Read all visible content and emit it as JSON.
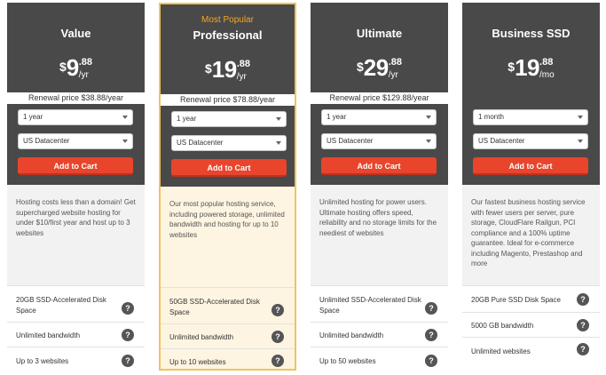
{
  "plans": [
    {
      "badge": "",
      "name": "Value",
      "currency": "$",
      "price_int": "9",
      "price_dec": ".88",
      "period": "/yr",
      "renewal": "Renewal price $38.88/year",
      "term": "1 year",
      "datacenter": "US Datacenter",
      "cta": "Add to Cart",
      "description": "Hosting costs less than a domain! Get supercharged website hosting for under $10/first year and host up to 3 websites",
      "features": [
        "20GB SSD-Accelerated Disk Space",
        "Unlimited bandwidth",
        "Up to 3 websites"
      ]
    },
    {
      "badge": "Most Popular",
      "name": "Professional",
      "currency": "$",
      "price_int": "19",
      "price_dec": ".88",
      "period": "/yr",
      "renewal": "Renewal price $78.88/year",
      "term": "1 year",
      "datacenter": "US Datacenter",
      "cta": "Add to Cart",
      "description": "Our most popular hosting service, including powered storage, unlimited bandwidth and hosting for up to 10 websites",
      "features": [
        "50GB SSD-Accelerated Disk Space",
        "Unlimited bandwidth",
        "Up to 10 websites"
      ]
    },
    {
      "badge": "",
      "name": "Ultimate",
      "currency": "$",
      "price_int": "29",
      "price_dec": ".88",
      "period": "/yr",
      "renewal": "Renewal price $129.88/year",
      "term": "1 year",
      "datacenter": "US Datacenter",
      "cta": "Add to Cart",
      "description": "Unlimited hosting for power users. Ultimate hosting offers speed, reliability and no storage limits for the neediest of websites",
      "features": [
        "Unlimited SSD-Accelerated Disk Space",
        "Unlimited bandwidth",
        "Up to 50 websites"
      ]
    },
    {
      "badge": "",
      "name": "Business SSD",
      "currency": "$",
      "price_int": "19",
      "price_dec": ".88",
      "period": "/mo",
      "renewal": "",
      "term": "1 month",
      "datacenter": "US Datacenter",
      "cta": "Add to Cart",
      "description": "Our fastest business hosting service with fewer users per server, pure storage, CloudFlare Railgun, PCI compliance and a 100% uptime guarantee. Ideal for e-commerce including Magento, Prestashop and more",
      "features": [
        "20GB Pure SSD Disk Space",
        "5000 GB bandwidth",
        "Unlimited websites"
      ]
    }
  ],
  "help_glyph": "?",
  "colors": {
    "header_bg": "#494949",
    "accent_badge": "#f5a623",
    "cta_bg": "#e8452c",
    "featured_border": "#f0c35e",
    "featured_bg": "#fdf5e2"
  }
}
